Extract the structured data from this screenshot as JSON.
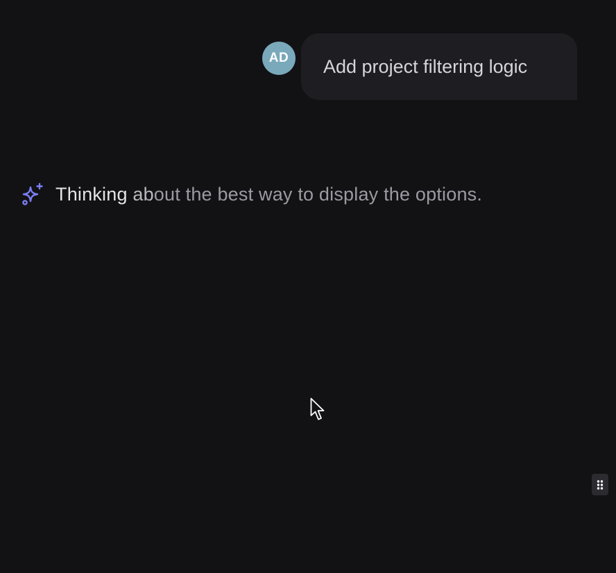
{
  "user_message": {
    "avatar_initials": "AD",
    "text": "Add project filtering logic"
  },
  "assistant_status": {
    "icon": "sparkle-icon",
    "text_bright": "Thinking",
    "text_mid": " ab",
    "text_dim": "out the best way to display the options."
  },
  "colors": {
    "background": "#121215",
    "avatar": "#79a9bb",
    "bubble": "#1e1e22",
    "sparkle": "#7b7ff5"
  },
  "handle": {
    "icon": "drag-handle-icon"
  }
}
